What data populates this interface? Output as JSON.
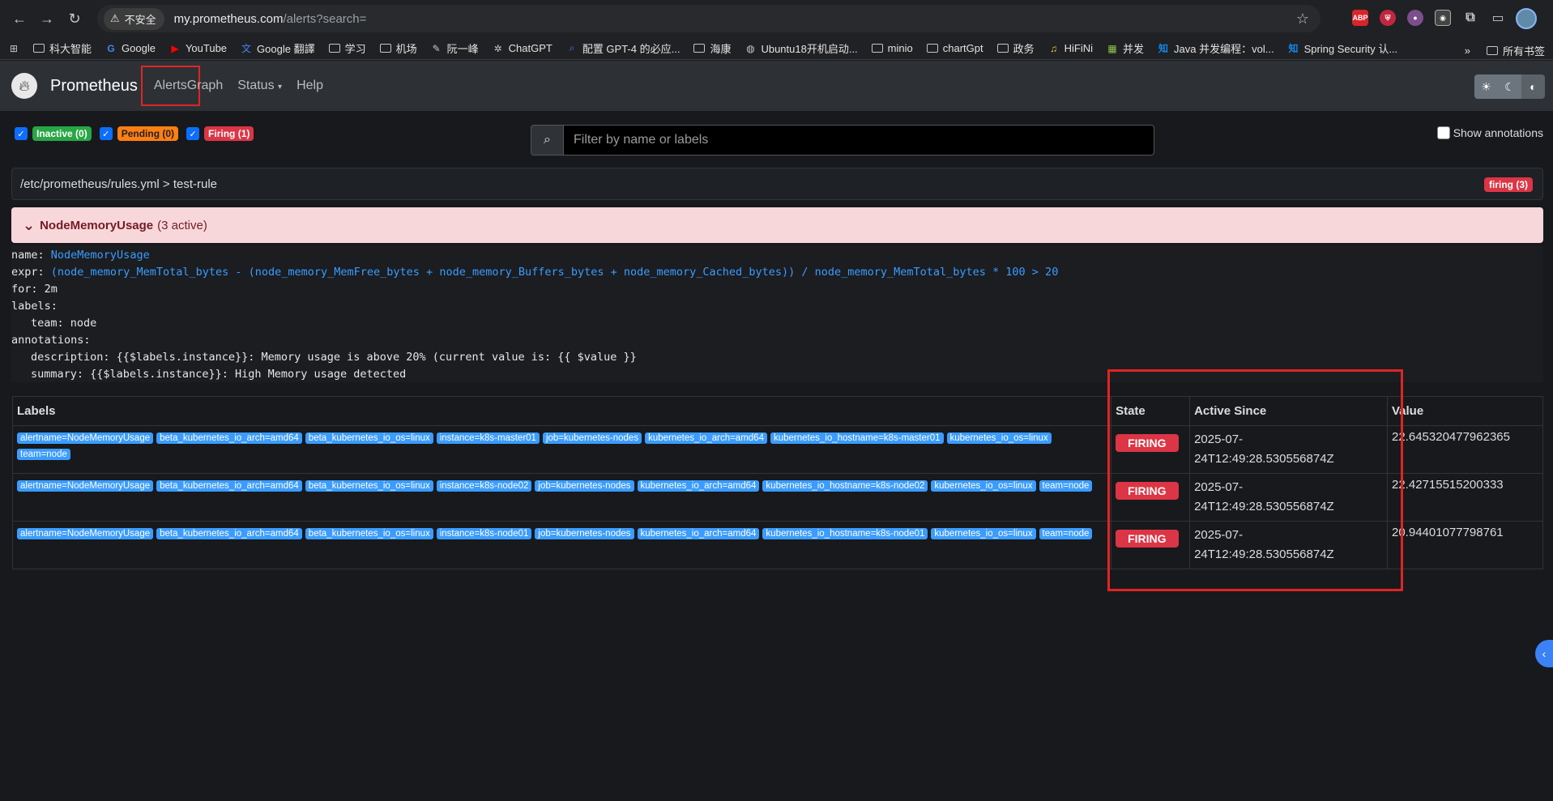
{
  "browser": {
    "security_label": "不安全",
    "url_host": "my.prometheus.com",
    "url_path": "/alerts?search=",
    "bookmarks": [
      "科大智能",
      "Google",
      "YouTube",
      "Google 翻譯",
      "学习",
      "机场",
      "阮一峰",
      "ChatGPT",
      "配置 GPT-4 的必应...",
      "海康",
      "Ubuntu18开机启动...",
      "minio",
      "chartGpt",
      "政务",
      "HiFiNi",
      "并发",
      "Java 并发编程：vol...",
      "Spring Security 认..."
    ],
    "more_label": "»",
    "all_bookmarks": "所有书签"
  },
  "navbar": {
    "brand": "Prometheus",
    "links": [
      "Alerts",
      "Graph",
      "Status",
      "Help"
    ]
  },
  "filters": {
    "inactive": "Inactive (0)",
    "pending": "Pending (0)",
    "firing": "Firing (1)",
    "search_placeholder": "Filter by name or labels",
    "show_annotations": "Show annotations"
  },
  "group": {
    "path": "/etc/prometheus/rules.yml > test-rule",
    "firing_count": "firing (3)"
  },
  "rule": {
    "name": "NodeMemoryUsage",
    "active": "(3 active)",
    "def_name_key": "name:",
    "def_name": "NodeMemoryUsage",
    "def_expr_key": "expr:",
    "def_expr": "(node_memory_MemTotal_bytes - (node_memory_MemFree_bytes + node_memory_Buffers_bytes + node_memory_Cached_bytes)) / node_memory_MemTotal_bytes * 100 > 20",
    "def_for": "for: 2m",
    "def_labels": "labels:",
    "def_team": "team: node",
    "def_annotations": "annotations:",
    "def_description": "description: {{$labels.instance}}: Memory usage is above 20% (current value is: {{ $value }}",
    "def_summary": "summary: {{$labels.instance}}: High Memory usage detected"
  },
  "table": {
    "headers": [
      "Labels",
      "State",
      "Active Since",
      "Value"
    ],
    "rows": [
      {
        "labels": [
          "alertname=NodeMemoryUsage",
          "beta_kubernetes_io_arch=amd64",
          "beta_kubernetes_io_os=linux",
          "instance=k8s-master01",
          "job=kubernetes-nodes",
          "kubernetes_io_arch=amd64",
          "kubernetes_io_hostname=k8s-master01",
          "kubernetes_io_os=linux",
          "team=node"
        ],
        "state": "FIRING",
        "since_1": "2025-07-",
        "since_2": "24T12:49:28.530556874Z",
        "value": "22.645320477962365"
      },
      {
        "labels": [
          "alertname=NodeMemoryUsage",
          "beta_kubernetes_io_arch=amd64",
          "beta_kubernetes_io_os=linux",
          "instance=k8s-node02",
          "job=kubernetes-nodes",
          "kubernetes_io_arch=amd64",
          "kubernetes_io_hostname=k8s-node02",
          "kubernetes_io_os=linux",
          "team=node"
        ],
        "state": "FIRING",
        "since_1": "2025-07-",
        "since_2": "24T12:49:28.530556874Z",
        "value": "22.42715515200333"
      },
      {
        "labels": [
          "alertname=NodeMemoryUsage",
          "beta_kubernetes_io_arch=amd64",
          "beta_kubernetes_io_os=linux",
          "instance=k8s-node01",
          "job=kubernetes-nodes",
          "kubernetes_io_arch=amd64",
          "kubernetes_io_hostname=k8s-node01",
          "kubernetes_io_os=linux",
          "team=node"
        ],
        "state": "FIRING",
        "since_1": "2025-07-",
        "since_2": "24T12:49:28.530556874Z",
        "value": "20.94401077798761"
      }
    ]
  }
}
